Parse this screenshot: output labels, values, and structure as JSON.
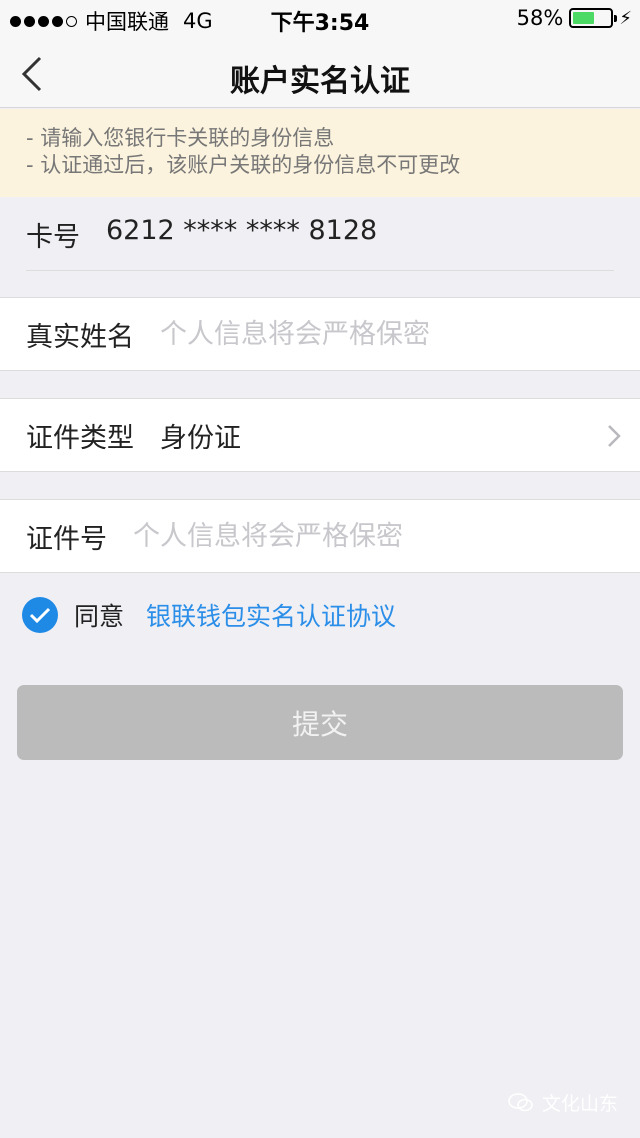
{
  "status_bar": {
    "carrier": "中国联通",
    "network": "4G",
    "time": "下午3:54",
    "battery": "58%",
    "battery_level": 0.58
  },
  "nav": {
    "title": "账户实名认证"
  },
  "notice": {
    "lines": [
      "-  请输入您银行卡关联的身份信息",
      "-  认证通过后，该账户关联的身份信息不可更改"
    ]
  },
  "card": {
    "label": "卡号",
    "number": "6212 **** **** 8128"
  },
  "form": {
    "name": {
      "label": "真实姓名",
      "placeholder": "个人信息将会严格保密"
    },
    "id_type": {
      "label": "证件类型",
      "value": "身份证"
    },
    "id_number": {
      "label": "证件号",
      "placeholder": "个人信息将会严格保密"
    }
  },
  "agreement": {
    "text": "同意",
    "link": "银联钱包实名认证协议",
    "checked": true
  },
  "submit": {
    "label": "提交"
  },
  "watermark": {
    "text": "文化山东"
  },
  "colors": {
    "accent": "#1e8ae6",
    "link": "#2b8ee8",
    "notice_bg": "#fbf3de",
    "submit_disabled": "#bbbbbb"
  }
}
